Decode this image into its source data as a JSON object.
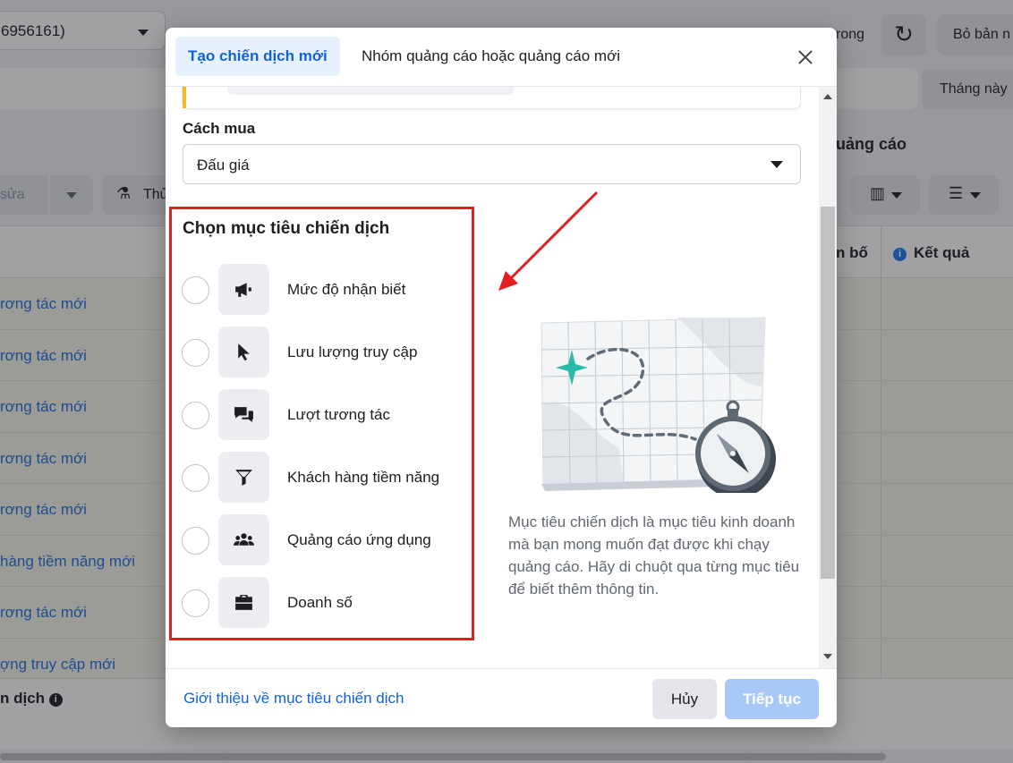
{
  "background": {
    "account_text": "6956161)",
    "topright_text": "rong",
    "revert_label": "Bỏ bản n",
    "month_label": "Tháng này",
    "section_title": "uảng cáo",
    "edit_label": "sửa",
    "test_label": "Thử",
    "col_distribution": "n bố",
    "col_results": "Kết quả",
    "rows": [
      "rơng tác mới",
      "rơng tác mới",
      "rơng tác mới",
      "rơng tác mới",
      "rơng tác mới",
      "hàng tiềm năng mới",
      "rơng tác mới",
      "ợng truy cập mới"
    ],
    "footer_label": "n dịch"
  },
  "modal": {
    "tabs": {
      "active": "Tạo chiến dịch mới",
      "other": "Nhóm quảng cáo hoặc quảng cáo mới"
    },
    "buying": {
      "label": "Cách mua",
      "value": "Đấu giá"
    },
    "objectives": {
      "title": "Chọn mục tiêu chiến dịch",
      "options": [
        {
          "label": "Mức độ nhận biết",
          "icon": "megaphone-icon"
        },
        {
          "label": "Lưu lượng truy cập",
          "icon": "cursor-icon"
        },
        {
          "label": "Lượt tương tác",
          "icon": "chat-bubbles-icon"
        },
        {
          "label": "Khách hàng tiềm năng",
          "icon": "funnel-icon"
        },
        {
          "label": "Quảng cáo ứng dụng",
          "icon": "people-icon"
        },
        {
          "label": "Doanh số",
          "icon": "briefcase-icon"
        }
      ]
    },
    "description": "Mục tiêu chiến dịch là mục tiêu kinh doanh mà bạn mong muốn đạt được khi chạy quảng cáo. Hãy di chuột qua từng mục tiêu để biết thêm thông tin.",
    "footer": {
      "link": "Giới thiệu về mục tiêu chiến dịch",
      "cancel": "Hủy",
      "continue": "Tiếp tục"
    }
  },
  "colors": {
    "accent": "#1164d6",
    "highlight_box": "#e02020",
    "arrow": "#e02020",
    "continue_disabled": "#a8c9f7"
  }
}
